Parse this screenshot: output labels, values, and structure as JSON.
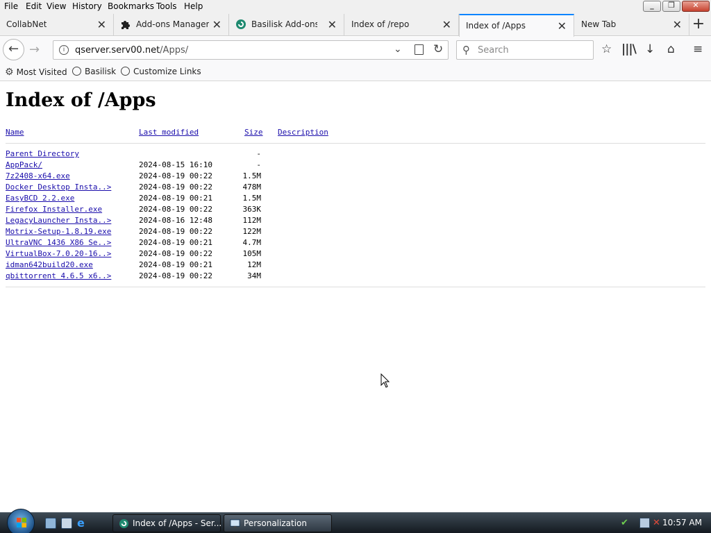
{
  "menu": {
    "file": "File",
    "edit": "Edit",
    "view": "View",
    "history": "History",
    "bookmarks": "Bookmarks",
    "tools": "Tools",
    "help": "Help"
  },
  "tabs": [
    {
      "label": "CollabNet"
    },
    {
      "label": "Add-ons Manager"
    },
    {
      "label": "Basilisk Add-ons -"
    },
    {
      "label": "Index of /repo"
    },
    {
      "label": "Index of /Apps"
    },
    {
      "label": "New Tab"
    }
  ],
  "nav": {
    "url_host": "qserver.serv00.net",
    "url_path": "/Apps/",
    "search_placeholder": "Search"
  },
  "bookmarks": {
    "most_visited": "Most Visited",
    "basilisk": "Basilisk",
    "customize": "Customize Links"
  },
  "page": {
    "title": "Index of /Apps",
    "headers": {
      "name": "Name",
      "last_modified": "Last modified",
      "size": "Size",
      "description": "Description"
    },
    "parent": {
      "name": "Parent Directory",
      "size": "-"
    },
    "rows": [
      {
        "name": "AppPack/",
        "date": "2024-08-15 16:10",
        "size": "-"
      },
      {
        "name": "7z2408-x64.exe",
        "date": "2024-08-19 00:22",
        "size": "1.5M"
      },
      {
        "name": "Docker Desktop Insta..>",
        "date": "2024-08-19 00:22",
        "size": "478M"
      },
      {
        "name": "EasyBCD 2.2.exe",
        "date": "2024-08-19 00:21",
        "size": "1.5M"
      },
      {
        "name": "Firefox Installer.exe",
        "date": "2024-08-19 00:22",
        "size": "363K"
      },
      {
        "name": "LegacyLauncher Insta..>",
        "date": "2024-08-16 12:48",
        "size": "112M"
      },
      {
        "name": "Motrix-Setup-1.8.19.exe",
        "date": "2024-08-19 00:22",
        "size": "122M"
      },
      {
        "name": "UltraVNC 1436 X86 Se..>",
        "date": "2024-08-19 00:21",
        "size": "4.7M"
      },
      {
        "name": "VirtualBox-7.0.20-16..>",
        "date": "2024-08-19 00:22",
        "size": "105M"
      },
      {
        "name": "idman642build20.exe",
        "date": "2024-08-19 00:21",
        "size": "12M"
      },
      {
        "name": "qbittorrent 4.6.5 x6..>",
        "date": "2024-08-19 00:22",
        "size": "34M"
      }
    ]
  },
  "taskbar": {
    "task1": "Index of /Apps - Ser...",
    "task2": "Personalization",
    "clock": "10:57 AM"
  },
  "colors": {
    "link": "#1a0dab",
    "tab_accent": "#0a84ff"
  }
}
